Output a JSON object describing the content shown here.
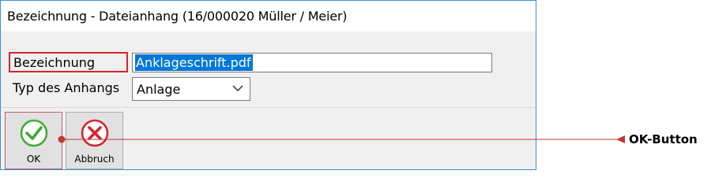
{
  "window": {
    "title": "Bezeichnung - Dateianhang (16/000020  Müller / Meier)"
  },
  "form": {
    "bezeichnung_label": "Bezeichnung",
    "bezeichnung_value": "Anklageschrift.pdf",
    "typ_label": "Typ des Anhangs",
    "typ_value": "Anlage"
  },
  "buttons": {
    "ok_label": "OK",
    "ok_icon": "check-icon",
    "cancel_label": "Abbruch",
    "cancel_icon": "close-icon"
  },
  "annotation": {
    "label": "OK-Button"
  },
  "colors": {
    "accent": "#3c8fd9",
    "highlight": "#d9232e",
    "selection": "#0078d7",
    "ok_green": "#3cae2f",
    "cancel_red": "#d4232e"
  }
}
